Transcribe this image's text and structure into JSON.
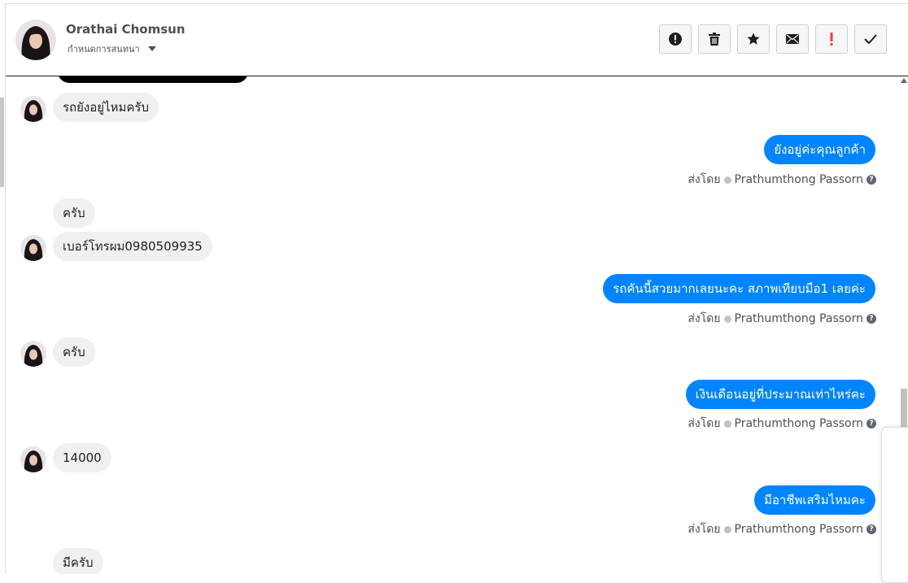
{
  "header": {
    "contact_name": "Orathai Chomsun",
    "subtitle": "กำหนดการสนทนา",
    "toolbar": [
      {
        "name": "spam-button",
        "icon": "exclamation-circle-icon"
      },
      {
        "name": "delete-button",
        "icon": "trash-icon"
      },
      {
        "name": "star-button",
        "icon": "star-icon"
      },
      {
        "name": "mark-unread-button",
        "icon": "envelope-icon"
      },
      {
        "name": "important-button",
        "icon": "exclamation-icon"
      },
      {
        "name": "mark-done-button",
        "icon": "check-icon"
      }
    ]
  },
  "messages": {
    "m1": "รถยังอยู่ไหมครับ",
    "m2": "ยังอยู่ค่ะคุณลูกค้า",
    "m3": "ครับ",
    "m4": "เบอร์โทรผม0980509935",
    "m5": "รถคันนี้สวยมากเลยนะคะ สภาพเทียบมือ1 เลยค่ะ",
    "m6": "ครับ",
    "m7": "เงินเดือนอยู่ที่ประมาณเท่าไหร่คะ",
    "m8": "14000",
    "m9": "มีอาชีพเสริมไหมคะ",
    "m10": "มีครับ"
  },
  "sent_by": {
    "label": "ส่งโดย",
    "agent": "Prathumthong Passorn"
  },
  "colors": {
    "outgoing_bubble": "#0084ff",
    "incoming_bubble": "#f1f0f0",
    "important_icon": "#fa383e"
  }
}
